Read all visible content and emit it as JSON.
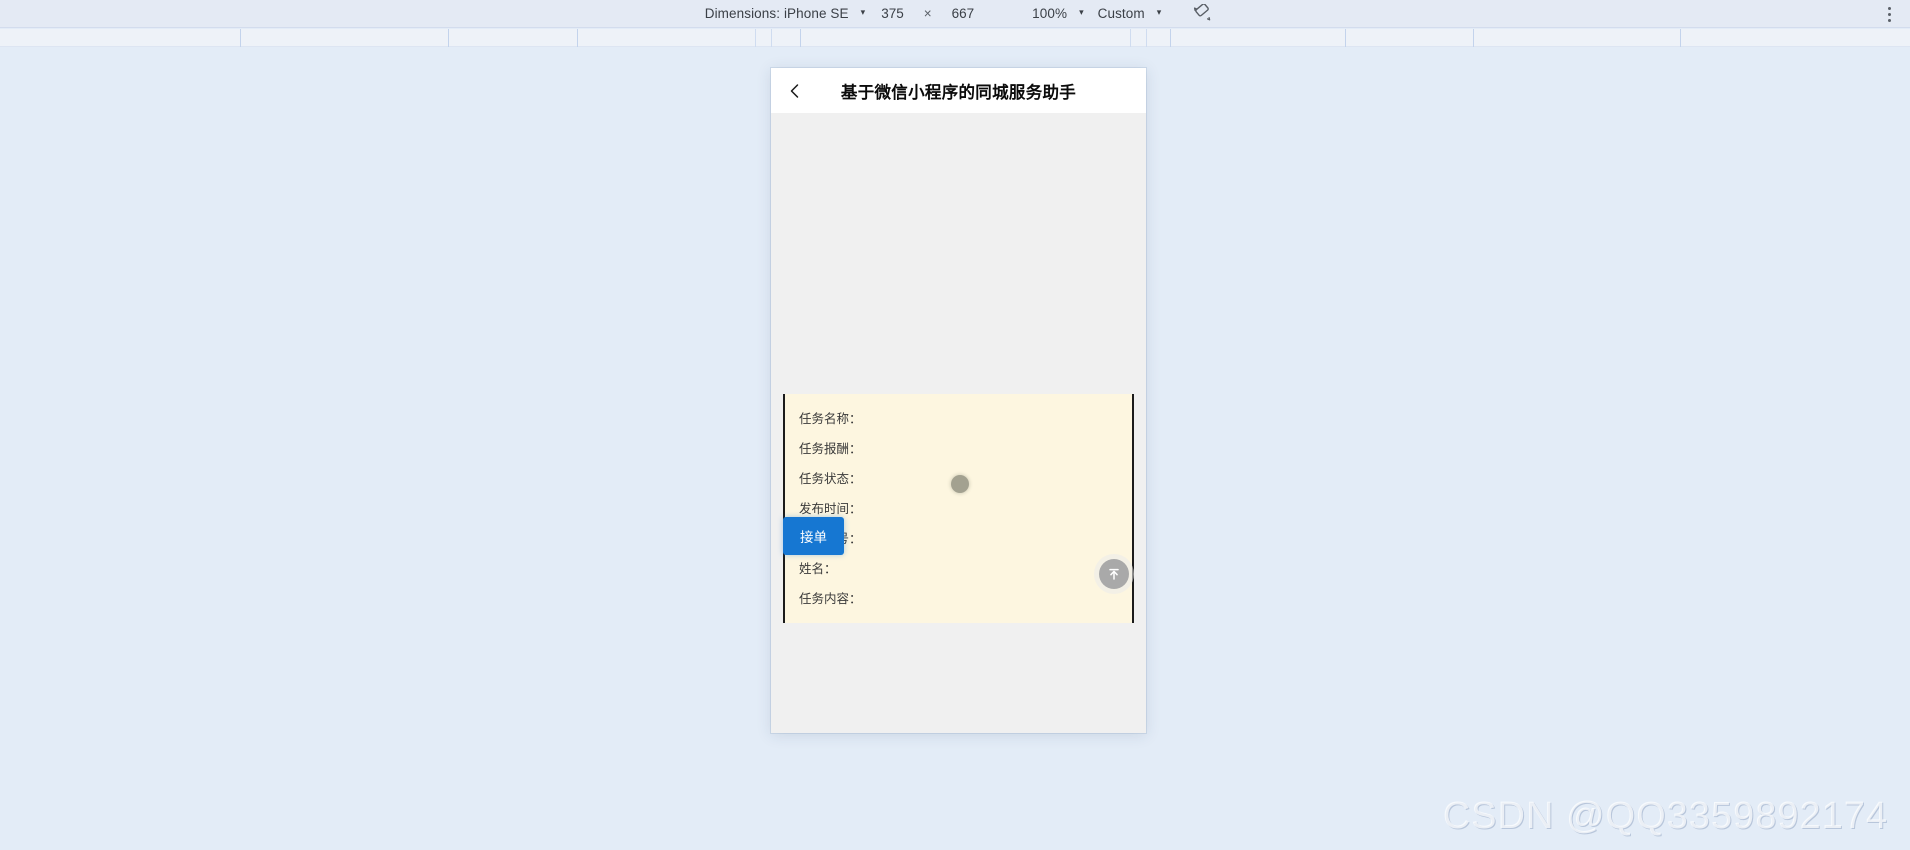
{
  "device_toolbar": {
    "dimensions_label": "Dimensions: iPhone SE",
    "width_value": "375",
    "separator": "×",
    "height_value": "667",
    "zoom_value": "100%",
    "throttling_value": "Custom",
    "rotate_icon": "rotate-icon",
    "overflow_icon": "more-vertical-icon",
    "caret": "▾"
  },
  "phone": {
    "header": {
      "back_icon": "chevron-left-icon",
      "title": "基于微信小程序的同城服务助手"
    },
    "task_panel": {
      "rows": [
        "任务名称：",
        "任务报酬：",
        "任务状态：",
        "发布时间：",
        "用户账号：",
        "姓名：",
        "任务内容："
      ],
      "background_color": "#fdf6e0",
      "border_color": "#1b1b1b"
    },
    "accept_button": {
      "label": "接单",
      "color": "#1677d2"
    },
    "back_to_top": {
      "icon": "arrow-up-to-line-icon",
      "color": "#a9a9a9"
    },
    "touch_indicator": {
      "name": "touch-point-indicator",
      "color": "#8a8a7a"
    }
  },
  "watermark": {
    "text": "CSDN @QQ3359892174"
  }
}
